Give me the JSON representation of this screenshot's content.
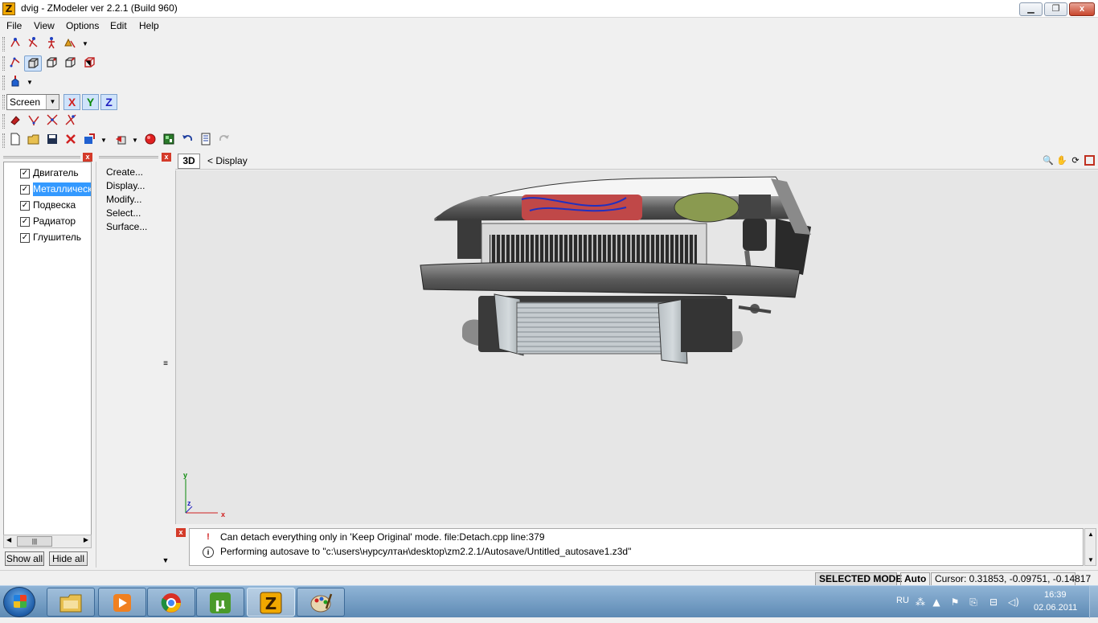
{
  "window": {
    "title": "dvig - ZModeler ver 2.2.1 (Build 960)",
    "app_icon_letter": "Z",
    "min_label": "▁",
    "max_label": "❐",
    "close_label": "x"
  },
  "menu": {
    "items": [
      "File",
      "View",
      "Options",
      "Edit",
      "Help"
    ]
  },
  "toolbar": {
    "coord_system": "Screen",
    "axes": [
      "X",
      "Y",
      "Z"
    ],
    "axis_colors": {
      "X": "#d02020",
      "Y": "#0a8a0a",
      "Z": "#2020c0"
    }
  },
  "objects_panel": {
    "items": [
      {
        "label": "Двигатель",
        "checked": true,
        "selected": false
      },
      {
        "label": "Металлическ",
        "checked": true,
        "selected": true
      },
      {
        "label": "Подвеска",
        "checked": true,
        "selected": false
      },
      {
        "label": "Радиатор",
        "checked": true,
        "selected": false
      },
      {
        "label": "Глушитель",
        "checked": true,
        "selected": false
      }
    ],
    "show_all": "Show all",
    "hide_all": "Hide all",
    "check_mark": "✓"
  },
  "commands_panel": {
    "items": [
      "Create...",
      "Display...",
      "Modify...",
      "Select...",
      "Surface..."
    ]
  },
  "viewport": {
    "mode_button": "3D",
    "breadcrumb": "<  Display",
    "axis_y": "y",
    "axis_x": "x",
    "axis_z": "z",
    "background": "#e6e6e6"
  },
  "log": {
    "rows": [
      {
        "type": "error",
        "icon": "!",
        "text": "Can detach everything only in 'Keep Original' mode. file:Detach.cpp line:379"
      },
      {
        "type": "info",
        "icon": "i",
        "text": "Performing autosave to \"c:\\users\\нурсултан\\desktop\\zm2.2.1/Autosave/Untitled_autosave1.z3d\""
      }
    ]
  },
  "status": {
    "mode": "SELECTED MODE",
    "auto": "Auto",
    "cursor": "Cursor: 0.31853, -0.09751, -0.14817"
  },
  "taskbar": {
    "apps": [
      {
        "name": "explorer-icon",
        "glyph": "🗂"
      },
      {
        "name": "media-player-icon",
        "glyph": "▶"
      },
      {
        "name": "chrome-icon",
        "glyph": "◉"
      },
      {
        "name": "utorrent-icon",
        "glyph": "µ"
      },
      {
        "name": "zmodeler-icon",
        "glyph": "Z"
      },
      {
        "name": "paint-icon",
        "glyph": "🎨"
      }
    ],
    "language": "RU",
    "time": "16:39",
    "date": "02.06.2011"
  }
}
